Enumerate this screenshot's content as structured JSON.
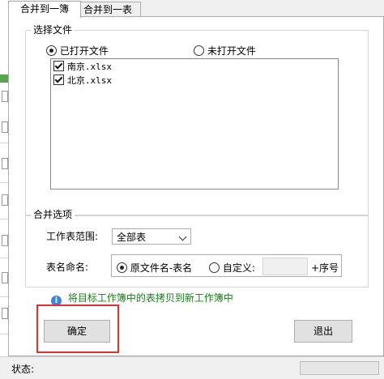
{
  "tabs": [
    {
      "label": "合并到一簿"
    },
    {
      "label": "合并到一表"
    }
  ],
  "select_files": {
    "legend": "选择文件",
    "radio_open": "已打开文件",
    "radio_closed": "未打开文件",
    "files": [
      {
        "name": "南京.xlsx",
        "checked": true
      },
      {
        "name": "北京.xlsx",
        "checked": true
      }
    ]
  },
  "merge_options": {
    "legend": "合并选项",
    "sheet_range_label": "工作表范围:",
    "sheet_range_value": "全部表",
    "sheet_naming_label": "表名命名:",
    "naming_original": "原文件名-表名",
    "naming_custom": "自定义:",
    "custom_input_value": "",
    "suffix_label": "+序号"
  },
  "info_message": "将目标工作簿中的表拷贝到新工作簿中",
  "buttons": {
    "ok": "确定",
    "exit": "退出"
  },
  "status": {
    "label": "状态:"
  },
  "colors": {
    "info_text": "#1a7a1a",
    "highlight_border": "#e03030",
    "info_icon": "#3a86d9"
  }
}
